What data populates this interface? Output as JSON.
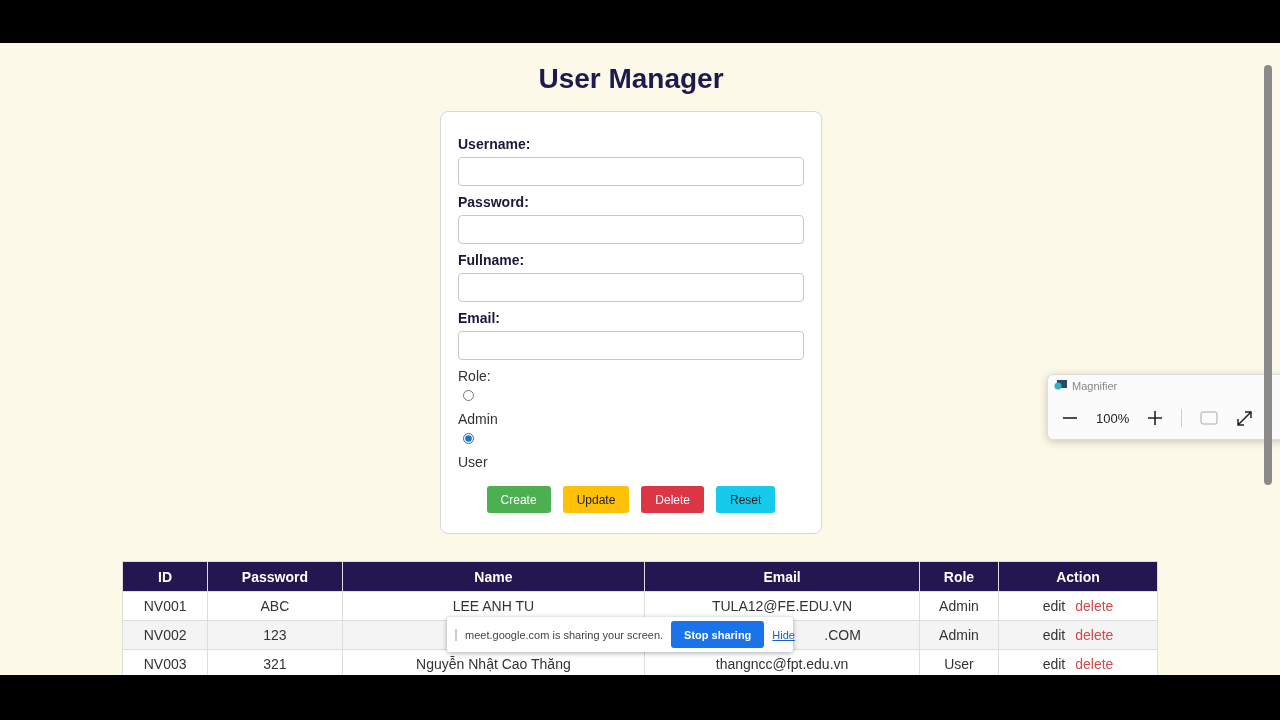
{
  "title": "User Manager",
  "form": {
    "fields": [
      {
        "label": "Username:"
      },
      {
        "label": "Password:"
      },
      {
        "label": "Fullname:"
      },
      {
        "label": "Email:"
      }
    ],
    "role": {
      "label": "Role:",
      "options": [
        {
          "label": "Admin",
          "selected": false
        },
        {
          "label": "User",
          "selected": true
        }
      ]
    },
    "buttons": [
      {
        "label": "Create",
        "kind": "create"
      },
      {
        "label": "Update",
        "kind": "update"
      },
      {
        "label": "Delete",
        "kind": "delete"
      },
      {
        "label": "Reset",
        "kind": "reset"
      }
    ]
  },
  "table": {
    "columns": [
      "ID",
      "Password",
      "Name",
      "Email",
      "Role",
      "Action"
    ],
    "rows": [
      {
        "id": "NV001",
        "password": "ABC",
        "name": "LEE ANH TU",
        "email": "TULA12@FE.EDU.VN",
        "role": "Admin",
        "edit": "edit",
        "delete": "delete"
      },
      {
        "id": "NV002",
        "password": "123",
        "email": ".COM",
        "role": "Admin",
        "edit": "edit",
        "delete": "delete"
      },
      {
        "id": "NV003",
        "password": "321",
        "name": "Nguyễn Nhật Cao Thăng",
        "email": "thangncc@fpt.edu.vn",
        "role": "User",
        "edit": "edit",
        "delete": "delete"
      }
    ]
  },
  "share_bar": {
    "message": "meet.google.com is sharing your screen.",
    "stop": "Stop sharing",
    "hide": "Hide"
  },
  "magnifier": {
    "title": "Magnifier",
    "zoom": "100%"
  }
}
